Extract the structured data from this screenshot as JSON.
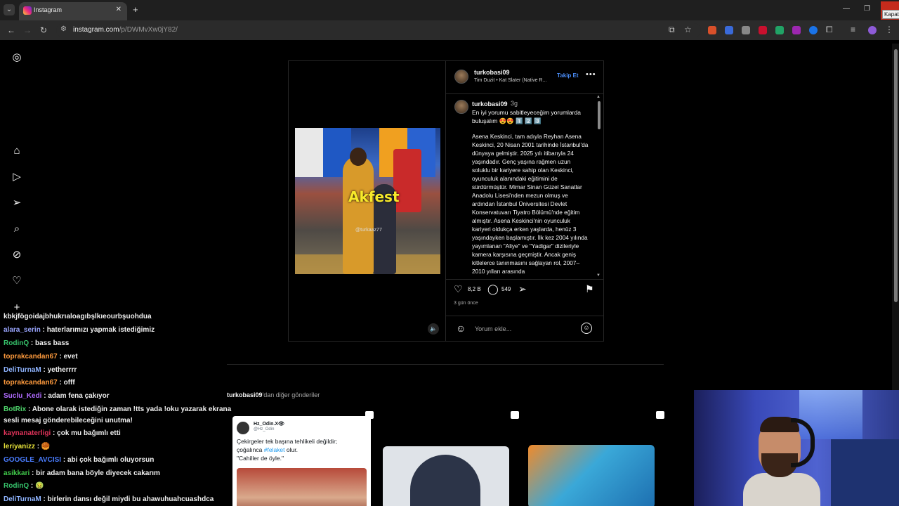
{
  "browser": {
    "tab_title": "Instagram",
    "url_host": "instagram.com",
    "url_path": "/p/DWMvXw0jY82/",
    "close_tooltip": "Kapat"
  },
  "post": {
    "username": "turkobasi09",
    "audio": "Tim Duzit • Kat Slater (Native R...",
    "follow_label": "Takip Et",
    "caption_user": "turkobasi09",
    "caption_time": "3g",
    "pinned_text": "En iyi yorumu sabitleyeceğim yorumlarda buluşalım 😍😍 1️⃣ 2️⃣ 3️⃣",
    "caption_body": "Asena Keskinci, tam adıyla Reyhan Asena Keskinci, 20 Nisan 2001 tarihinde İstanbul'da dünyaya gelmiştir. 2025 yılı itibarıyla 24 yaşındadır. Genç yaşına rağmen uzun soluklu bir kariyere sahip olan Keskinci, oyunculuk alanındaki eğitimini de sürdürmüştür. Mimar Sinan Güzel Sanatlar Anadolu Lisesi'nden mezun olmuş ve ardından İstanbul Üniversitesi Devlet Konservatuvarı Tiyatro Bölümü'nde eğitim almıştır. Asena Keskinci'nin oyunculuk kariyeri oldukça erken yaşlarda, henüz 3 yaşındayken başlamıştır. İlk kez 2004 yılında yayımlanan \"Aliye\" ve \"Yadigar\" dizileriyle kamera karşısına geçmiştir. Ancak geniş kitlelerce tanınmasını sağlayan rol, 2007–2010 yılları arasında",
    "video_overlay_text": "Akfest",
    "video_watermark": "@turkaaz77",
    "likes": "8,2 B",
    "comments": "549",
    "posted_ago": "3 gün önce",
    "comment_placeholder": "Yorum ekle..."
  },
  "more_posts": {
    "username": "turkobasi09",
    "suffix": "'dan diğer gönderiler",
    "tweet": {
      "name": "Hz_Odin.X👁",
      "handle": "@Hz_Odin",
      "line1": "Çekirgeler tek başına tehlikeli değildir;",
      "line2_pre": "çoğalınca ",
      "line2_tag": "#felaket",
      "line2_post": " olur.",
      "line3": "\"Cahiller de öyle.\""
    }
  },
  "chat": [
    {
      "user": "",
      "text": "kbkjfögoidajbhukrıaloagıbşlkıeourbşuohdua",
      "color": "#f0f0f0"
    },
    {
      "user": "alara_serin",
      "text": " : haterlarımızı yapmak istediğimiz",
      "color": "#9aa6ff"
    },
    {
      "user": "RodinQ",
      "text": " : bass bass",
      "color": "#36c26b"
    },
    {
      "user": "toprakcandan67",
      "text": " : evet",
      "color": "#ff9b3d"
    },
    {
      "user": "DeliTurnaM",
      "text": " : yetherrrr",
      "color": "#8fb4ff"
    },
    {
      "user": "toprakcandan67",
      "text": " : offf",
      "color": "#ff9b3d"
    },
    {
      "user": "Suclu_Kedi",
      "text": " : adam fena çakıyor",
      "color": "#b06bff"
    },
    {
      "user": "BotRix",
      "text": " : Abone olarak istediğin zaman !tts yada !oku yazarak ekrana",
      "color": "#4ed36b"
    },
    {
      "user": "",
      "text": "sesli mesaj gönderebileceğini unutma!",
      "color": "#f0f0f0"
    },
    {
      "user": "kaynanaterligi",
      "text": " : çok mu bağımlı etti",
      "color": "#e0335a"
    },
    {
      "user": "leriyanizz",
      "text": " : 🥮",
      "color": "#e7e23a"
    },
    {
      "user": "GOOGLE_AVCISI",
      "text": " : abi çok bağımlı oluyorsun",
      "color": "#4a7dff"
    },
    {
      "user": "asikkari",
      "text": " : bir adam bana böyle diyecek cakarım",
      "color": "#40c94a"
    },
    {
      "user": "RodinQ",
      "text": " : 🤢",
      "color": "#36c26b"
    },
    {
      "user": "DeliTurnaM",
      "text": " : birlerin dansı değil miydi bu ahawuhuahcuashdca",
      "color": "#8fb4ff"
    }
  ],
  "icons": {
    "instagram": "instagram-logo-icon",
    "home": "home-icon",
    "reels": "reels-icon",
    "messages": "send-icon",
    "search": "search-icon",
    "explore": "explore-icon",
    "notifications": "heart-icon",
    "create": "plus-icon"
  }
}
